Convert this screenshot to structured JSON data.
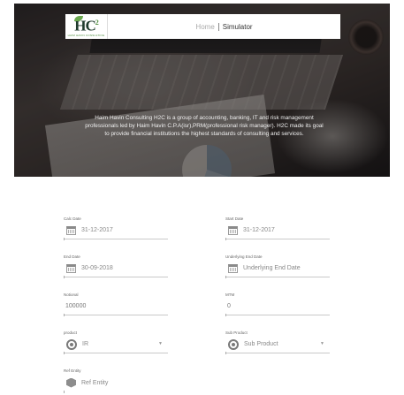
{
  "header": {
    "logo_text": "H2C",
    "logo_subtitle": "HAIM HAVIN CONSULTING",
    "nav": {
      "home": "Home",
      "simulator": "Simulator"
    },
    "intro": "Haim Havin Consulting H2C is a group of accounting, banking, IT and risk management professionals led by Haim Havin C.P.A(isr),PRM(professional risk manager). H2C made its goal to provide financial institutions the highest standards of consulting and services."
  },
  "form": {
    "calc_date": {
      "label": "Calc Date",
      "value": "31-12-2017",
      "icon": "calendar-icon"
    },
    "start_date": {
      "label": "Start Date",
      "value": "31-12-2017",
      "icon": "calendar-icon"
    },
    "end_date": {
      "label": "End Date",
      "value": "30-09-2018",
      "icon": "calendar-icon"
    },
    "underlying_end_date": {
      "label": "Underlying End Date",
      "placeholder": "Underlying End Date",
      "icon": "calendar-icon"
    },
    "notional": {
      "label": "Notional",
      "value": "100000"
    },
    "mtm": {
      "label": "MTM",
      "value": "0"
    },
    "product": {
      "label": "product",
      "value": "IR",
      "icon": "target-icon"
    },
    "sub_product": {
      "label": "Sub Product",
      "placeholder": "Sub Product",
      "icon": "target-icon"
    },
    "ref_entity": {
      "label": "Ref Entity",
      "placeholder": "Ref Entity",
      "icon": "cube-icon"
    }
  }
}
